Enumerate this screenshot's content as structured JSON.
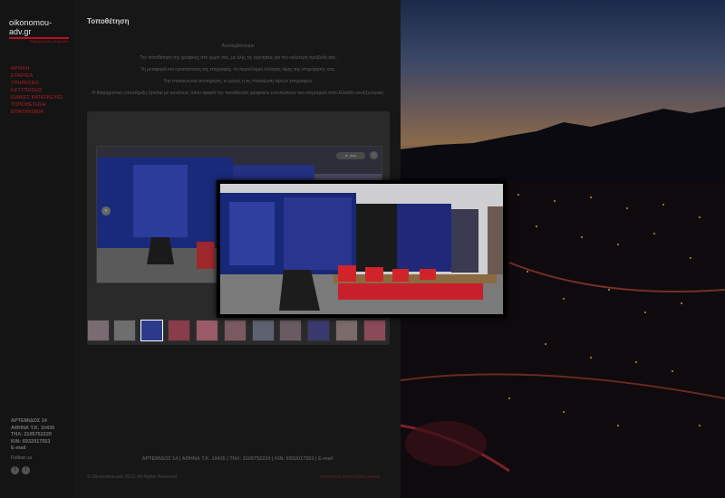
{
  "logo": {
    "name": "oikonomou-adv.gr",
    "tagline": "διαφημιστικές υπηρεσίες"
  },
  "nav": {
    "items": [
      "ΑΡΧΙΚΗ",
      "ΕΤΑΙΡΕΙΑ",
      "ΥΠΗΡΕΣΙΕΣ",
      "ΕΚΤΥΠΩΣΕΙΣ",
      "ΕΙΔΙΚΕΣ ΚΑΤΑΣΚΕΥΕΣ",
      "ΤΟΠΟΘΕΤΗΣΗ",
      "ΕΠΙΚΟΙΝΩΝΙΑ"
    ]
  },
  "contact": {
    "address": "ΑΡΤΕΜΙΔΟΣ 14",
    "city": "ΑΘΗΝΑ Τ.Κ. 10435",
    "phone": "ΤΗΛ: 2105752220",
    "mobile": "ΚΙΝ: 6932017553",
    "email": "E-mail"
  },
  "social": {
    "label": "Follow us",
    "icons": [
      "facebook-icon",
      "twitter-icon"
    ]
  },
  "page": {
    "title": "Τοποθέτηση",
    "intro": [
      "Αναλαμβάνουμε:",
      "Την τοποθέτηση της γραφικής στο χώρο σας, με όλες τις εγγυήσεις για την καλύτερη προβολή σας.",
      "Τη μεταφορά και εγκατάσταση της επιγραφής, το περιτύλιγμα αλλαγής όψης της επιχείρησης σας.",
      "Την επισκευή και συντήρηση, το μέρος ή τις πλαισίωση όψεων επιγραφών.",
      "Η διαφημιστική υποστήριξη ζητείται με συνέπεια, όπου αφορά την τοποθέτηση γραφικών εκτυπώσεων και επιγραφών στην Ελλάδα και Εξωτερικό."
    ]
  },
  "gallery": {
    "play_label": "► play",
    "prev_label": "‹",
    "next_label": "›",
    "thumb_colors": [
      "#7a6a72",
      "#6e6e6e",
      "#2b3a8a",
      "#8a3b4c",
      "#9a5a66",
      "#7a5a60",
      "#5e6270",
      "#6a5a62",
      "#3a3a70",
      "#7a6a6a",
      "#8a4a56"
    ],
    "active_thumb": 2
  },
  "footer": {
    "address_line": "ΑΡΤΕΜΙΔΟΣ 14 | ΑΘΗΝΑ Τ.Κ. 10435 | ΤΗΛ: 2105752220 | ΚΙΝ: 6932017553 | E-mail",
    "copyright": "© Oikonomou-adv 2012. All Rights Reserved",
    "credit": "κατασκευή ιστοσελίδας ssweb"
  },
  "colors": {
    "accent": "#b11d24",
    "panel": "#171717",
    "sidebar": "#141414"
  }
}
